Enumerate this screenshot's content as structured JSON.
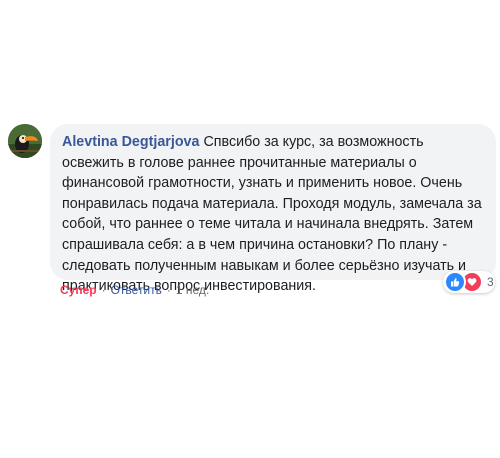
{
  "comment": {
    "author": "Alevtina Degtjarjova",
    "text": "Спвсибо за курс, за возможность освежить в голове раннее прочитанные материалы о финансовой грамотности, узнать и применить новое. Очень понравилась подача материала. Проходя модуль, замечала за собой, что раннее о теме читала и начинала внедрять. Затем спрашивала себя: а в чем причина остановки? По плану - следовать полученным навыкам и более серьёзно изучать и практиковать вопрос инвестирования."
  },
  "reactions": {
    "icons": [
      "like-icon",
      "love-icon"
    ],
    "count": "3",
    "colors": {
      "like": "#2d88ff",
      "love": "#f33e58"
    }
  },
  "actions": {
    "reaction_label": "Супер",
    "separator": "·",
    "reply_label": "Ответить",
    "timestamp": "1 нед."
  },
  "colors": {
    "author": "#385898",
    "bubble": "#f2f3f5",
    "reaction_selected": "#f33e58",
    "meta": "#65676b"
  }
}
